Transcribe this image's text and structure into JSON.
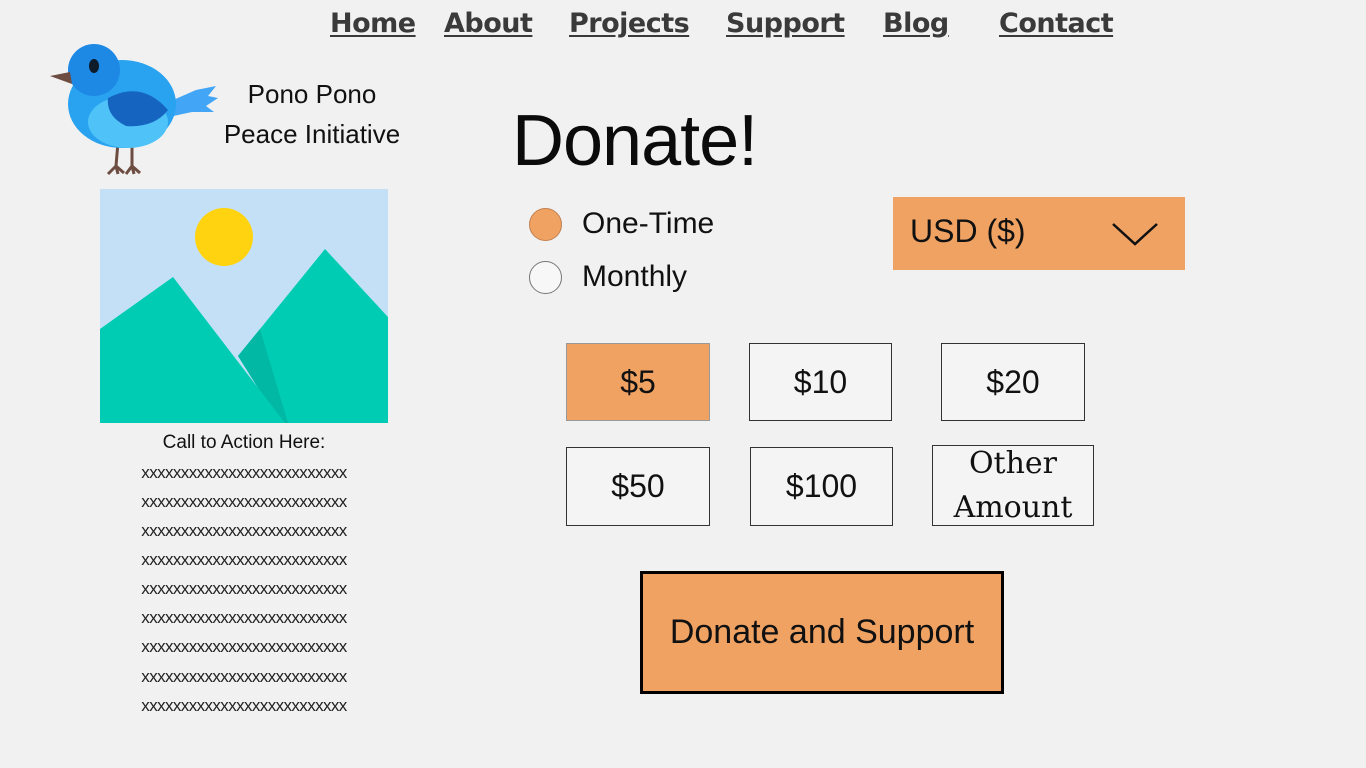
{
  "nav": {
    "items": [
      {
        "label": "Home"
      },
      {
        "label": "About"
      },
      {
        "label": "Projects"
      },
      {
        "label": "Support"
      },
      {
        "label": "Blog"
      },
      {
        "label": "Contact"
      }
    ]
  },
  "brand": {
    "logo_icon": "bird-icon",
    "name_line1": "Pono Pono",
    "name_line2": "Peace Initiative"
  },
  "sidebar": {
    "image_icon": "image-placeholder-icon",
    "cta_title": "Call to Action Here:",
    "cta_lines": [
      "xxxxxxxxxxxxxxxxxxxxxxxxxx",
      "xxxxxxxxxxxxxxxxxxxxxxxxxx",
      "xxxxxxxxxxxxxxxxxxxxxxxxxx",
      "xxxxxxxxxxxxxxxxxxxxxxxxxx",
      "xxxxxxxxxxxxxxxxxxxxxxxxxx",
      "xxxxxxxxxxxxxxxxxxxxxxxxxx",
      "xxxxxxxxxxxxxxxxxxxxxxxxxx",
      "xxxxxxxxxxxxxxxxxxxxxxxxxx",
      "xxxxxxxxxxxxxxxxxxxxxxxxxx"
    ]
  },
  "donate": {
    "title": "Donate!",
    "frequency": {
      "options": [
        {
          "label": "One-Time",
          "checked": true
        },
        {
          "label": "Monthly",
          "checked": false
        }
      ]
    },
    "currency": {
      "selected": "USD ($)",
      "icon": "chevron-down-icon"
    },
    "amounts": [
      {
        "label": "$5",
        "selected": true
      },
      {
        "label": "$10",
        "selected": false
      },
      {
        "label": "$20",
        "selected": false
      },
      {
        "label": "$50",
        "selected": false
      },
      {
        "label": "$100",
        "selected": false
      },
      {
        "label_line1": "Other",
        "label_line2": "Amount",
        "selected": false
      }
    ],
    "submit_label": "Donate and Support"
  },
  "colors": {
    "accent": "#f0a263",
    "background": "#f1f1f1",
    "sky": "#c4e0f6",
    "sun": "#ffd30f",
    "mountain": "#00ccb4",
    "bird_blue": "#2196f3"
  }
}
